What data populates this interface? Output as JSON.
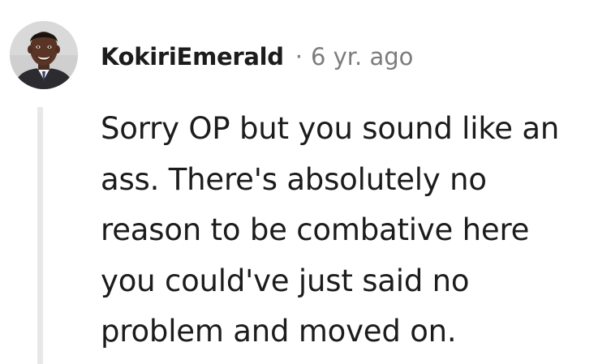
{
  "comment": {
    "author": "KokiriEmerald",
    "separator": "·",
    "timestamp": "6 yr. ago",
    "avatar_icon": "user-avatar-icon",
    "body_lines": [
      "Sorry OP but you sound like an",
      "ass. There's absolutely no",
      "reason to be combative here",
      "you could've just said no",
      "problem and moved on."
    ]
  },
  "colors": {
    "username": "#1c1c1c",
    "meta": "#7c7c7c",
    "thread_line": "#e8e8e8",
    "background": "#ffffff"
  }
}
